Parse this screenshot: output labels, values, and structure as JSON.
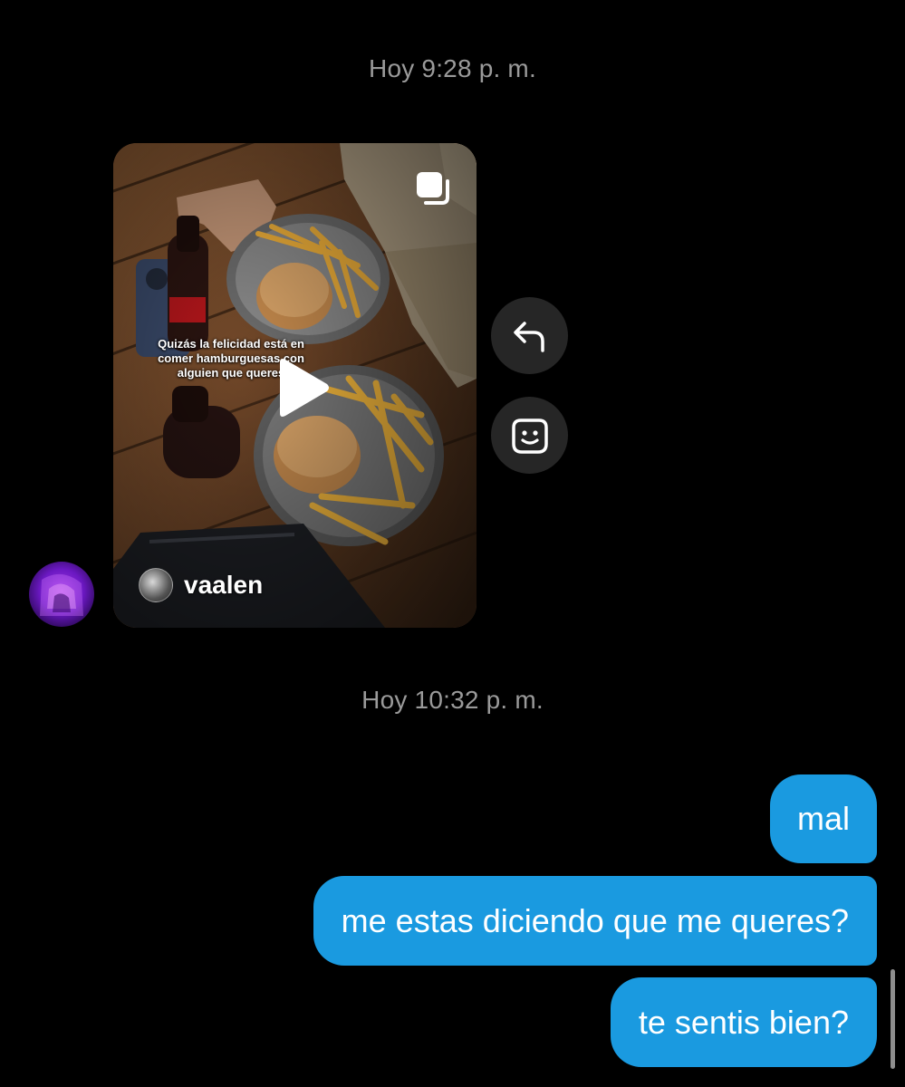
{
  "timestamps": {
    "first": "Hoy 9:28 p. m.",
    "second": "Hoy 10:32 p. m."
  },
  "shared_reel": {
    "caption": "Quizás la felicidad está en comer hamburguesas con alguien que queres",
    "author": "vaalen",
    "icons": [
      "multi-post-icon",
      "play-icon"
    ]
  },
  "actions": {
    "reply_icon": "reply-arrow-icon",
    "react_icon": "smiley-face-icon"
  },
  "messages": [
    {
      "text": "mal",
      "direction": "sent"
    },
    {
      "text": "me estas diciendo que me queres?",
      "direction": "sent"
    },
    {
      "text": "te sentis bien?",
      "direction": "sent"
    }
  ],
  "colors": {
    "background": "#000000",
    "sent_bubble": "#1a9ae0",
    "action_button": "#262626",
    "timestamp_text": "#9a9a9a"
  }
}
